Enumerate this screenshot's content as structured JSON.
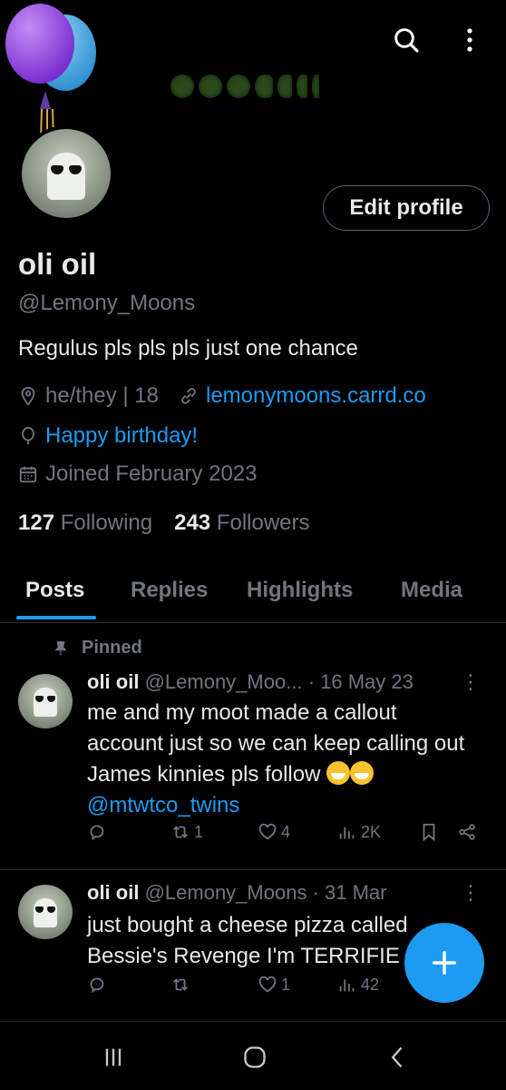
{
  "profile": {
    "name": "oli oil",
    "handle": "@Lemony_Moons",
    "bio": "Regulus pls pls pls just one chance",
    "location": "he/they | 18",
    "website": "lemonymoons.carrd.co",
    "birthday": "Happy birthday!",
    "joined": "Joined February 2023",
    "following_count": "127",
    "following_label": "Following",
    "followers_count": "243",
    "followers_label": "Followers",
    "edit_label": "Edit profile"
  },
  "tabs": [
    "Posts",
    "Replies",
    "Highlights",
    "Media"
  ],
  "posts": [
    {
      "pinned_label": "Pinned",
      "name": "oli oil",
      "handle": "@Lemony_Moo...",
      "date": "· 16 May 23",
      "text": "me and my moot made a callout account just so we can keep calling out James kinnies pls follow",
      "mention": "@mtwtco_twins",
      "reposts": "1",
      "likes": "4",
      "views": "2K"
    },
    {
      "name": "oli oil",
      "handle": "@Lemony_Moons",
      "date": "· 31 Mar",
      "text": "just bought a cheese pizza called Bessie's Revenge I'm TERRIFIE",
      "likes": "1",
      "views": "42"
    }
  ],
  "colors": {
    "accent": "#1d9bf0",
    "muted": "#71767b",
    "text": "#e7e9ea",
    "background": "#000000"
  }
}
